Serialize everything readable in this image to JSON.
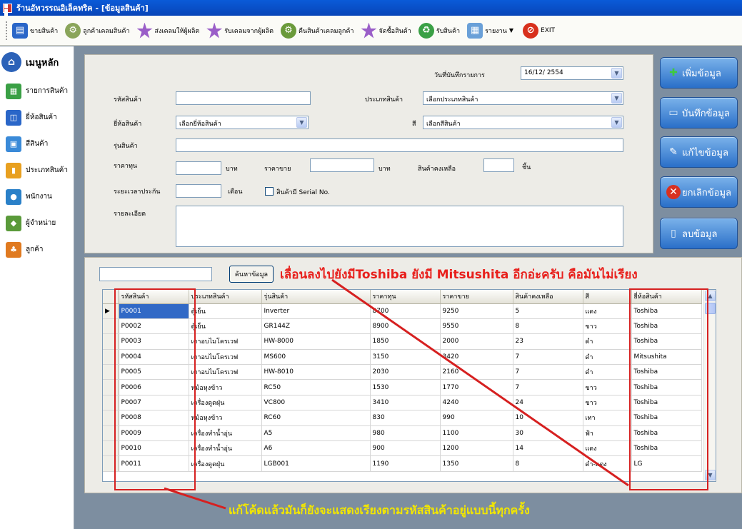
{
  "window": {
    "title": "ร้านอัทวรรณอิเล็คทริค - [ข้อมูลสินค้า]"
  },
  "toolbar": {
    "items": [
      {
        "label": "ขายสินค้า",
        "icon": "cashier-icon"
      },
      {
        "label": "ลูกค้าเคลมสินค้า",
        "icon": "gear-icon"
      },
      {
        "label": "ส่งเคลมให้ผู้ผลิต",
        "icon": "star-icon"
      },
      {
        "label": "รับเคลมจากผู้ผลิต",
        "icon": "star-icon"
      },
      {
        "label": "คืนสินค้าเคลมลูกค้า",
        "icon": "gear-icon"
      },
      {
        "label": "จัดซื้อสินค้า",
        "icon": "star-icon"
      },
      {
        "label": "รับสินค้า",
        "icon": "recycle-icon"
      },
      {
        "label": "รายงาน",
        "icon": "report-icon"
      },
      {
        "label": "EXIT",
        "icon": "exit-icon"
      }
    ]
  },
  "sidebar": {
    "home": "เมนูหลัก",
    "items": [
      "รายการสินค้า",
      "ยี่ห้อสินค้า",
      "สีสินค้า",
      "ประเภทสินค้า",
      "พนักงาน",
      "ผู้จำหน่าย",
      "ลูกค้า"
    ]
  },
  "form": {
    "record_date_label": "วันที่บันทึกรายการ",
    "record_date_value": "16/12/ 2554",
    "product_code_label": "รหัสสินค้า",
    "product_code_value": "",
    "product_type_label": "ประเภทสินค้า",
    "product_type_value": "เลือกประเภทสินค้า",
    "brand_label": "ยี่ห้อสินค้า",
    "brand_value": "เลือกยี่ห้อสินค้า",
    "color_label": "สี",
    "color_value": "เลือกสีสินค้า",
    "model_label": "รุ่นสินค้า",
    "model_value": "",
    "cost_label": "ราคาทุน",
    "baht_1": "บาท",
    "sell_price_label": "ราคาขาย",
    "baht_2": "บาท",
    "stock_label": "สินค้าคงเหลือ",
    "unit_label": "ชิ้น",
    "warranty_label": "ระยะเวลาประกัน",
    "month_label": "เดือน",
    "serial_checkbox_label": "สินค้ามี Serial No.",
    "detail_label": "รายละเอียด"
  },
  "actions": {
    "add": "เพิ่มข้อมูล",
    "save": "บันทึกข้อมูล",
    "edit": "แก้ไขข้อมูล",
    "cancel": "ยกเลิกข้อมูล",
    "delete": "ลบข้อมูล"
  },
  "search": {
    "button": "ค้นหาข้อมูล",
    "value": ""
  },
  "annotations": {
    "top": "เลื่อนลงไปยังมีToshiba ยังมี Mitsushita อีกอ่ะครับ คือมันไม่เรียง",
    "bottom": "แก้โค้ดแล้วมันก็ยังจะแสดงเรียงตามรหัสสินค้าอยู่แบบนี้ทุกครั้ง"
  },
  "grid": {
    "columns": [
      "รหัสสินค้า",
      "ประเภทสินค้า",
      "รุ่นสินค้า",
      "ราคาทุน",
      "ราคาขาย",
      "สินค้าคงเหลือ",
      "สี",
      "ยี่ห้อสินค้า"
    ],
    "rows": [
      [
        "P0001",
        "ตู้เย็น",
        "Inverter",
        "8700",
        "9250",
        "5",
        "แดง",
        "Toshiba"
      ],
      [
        "P0002",
        "ตู้เย็น",
        "GR144Z",
        "8900",
        "9550",
        "8",
        "ขาว",
        "Toshiba"
      ],
      [
        "P0003",
        "เตาอบไมโครเวฟ",
        "HW-8000",
        "1850",
        "2000",
        "23",
        "ดำ",
        "Toshiba"
      ],
      [
        "P0004",
        "เตาอบไมโครเวฟ",
        "MS600",
        "3150",
        "3420",
        "7",
        "ดำ",
        "Mitsushita"
      ],
      [
        "P0005",
        "เตาอบไมโครเวฟ",
        "HW-8010",
        "2030",
        "2160",
        "7",
        "ดำ",
        "Toshiba"
      ],
      [
        "P0006",
        "หม้อหุงข้าว",
        "RC50",
        "1530",
        "1770",
        "7",
        "ขาว",
        "Toshiba"
      ],
      [
        "P0007",
        "เครื่องดูดฝุ่น",
        "VC800",
        "3410",
        "4240",
        "24",
        "ขาว",
        "Toshiba"
      ],
      [
        "P0008",
        "หม้อหุงข้าว",
        "RC60",
        "830",
        "990",
        "10",
        "เทา",
        "Toshiba"
      ],
      [
        "P0009",
        "เครื่องทำน้ำอุ่น",
        "A5",
        "980",
        "1100",
        "30",
        "ฟ้า",
        "Toshiba"
      ],
      [
        "P0010",
        "เครื่องทำน้ำอุ่น",
        "A6",
        "900",
        "1200",
        "14",
        "แดง",
        "Toshiba"
      ],
      [
        "P0011",
        "เครื่องดูดฝุ่น",
        "LGB001",
        "1190",
        "1350",
        "8",
        "ดำ-แดง",
        "LG"
      ]
    ]
  },
  "colors": {
    "annotation_red": "#e8201c",
    "annotation_yellow": "#f2e600",
    "selection": "#3169c6"
  }
}
